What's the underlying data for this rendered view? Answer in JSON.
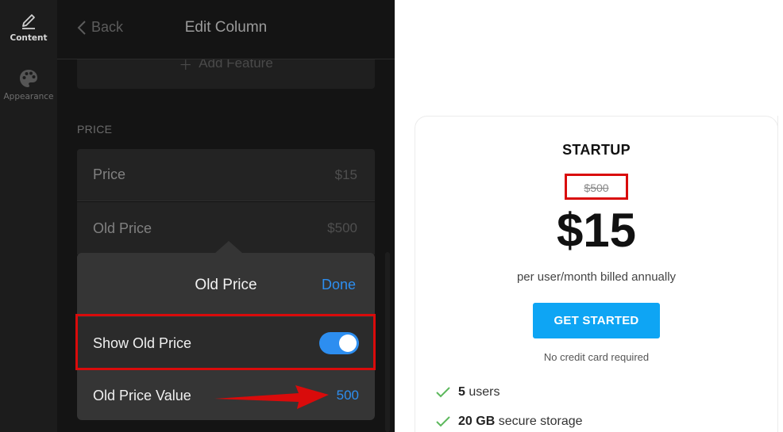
{
  "sidebar": {
    "items": [
      {
        "label": "Content",
        "icon": "pencil-icon",
        "active": true
      },
      {
        "label": "Appearance",
        "icon": "palette-icon",
        "active": false
      }
    ]
  },
  "panel": {
    "back_label": "Back",
    "title": "Edit Column",
    "add_feature_label": "Add Feature",
    "section_label": "PRICE",
    "fields": [
      {
        "label": "Price",
        "value": "$15"
      },
      {
        "label": "Old Price",
        "value": "$500"
      }
    ]
  },
  "popover": {
    "title": "Old Price",
    "done_label": "Done",
    "show_old_price_label": "Show Old Price",
    "show_old_price_on": true,
    "old_price_value_label": "Old Price Value",
    "old_price_value": "500"
  },
  "preview": {
    "plan_name": "STARTUP",
    "old_price": "$500",
    "price": "$15",
    "billing": "per user/month billed annually",
    "cta_label": "GET STARTED",
    "note": "No credit card required",
    "features": [
      {
        "bold": "5",
        "text": "users"
      },
      {
        "bold": "20 GB",
        "text": "secure storage"
      }
    ]
  },
  "colors": {
    "accent_blue": "#2d8ef0",
    "cta_blue": "#0ea5f4",
    "check_green": "#5cb85c",
    "annotation_red": "#d90b0b"
  }
}
